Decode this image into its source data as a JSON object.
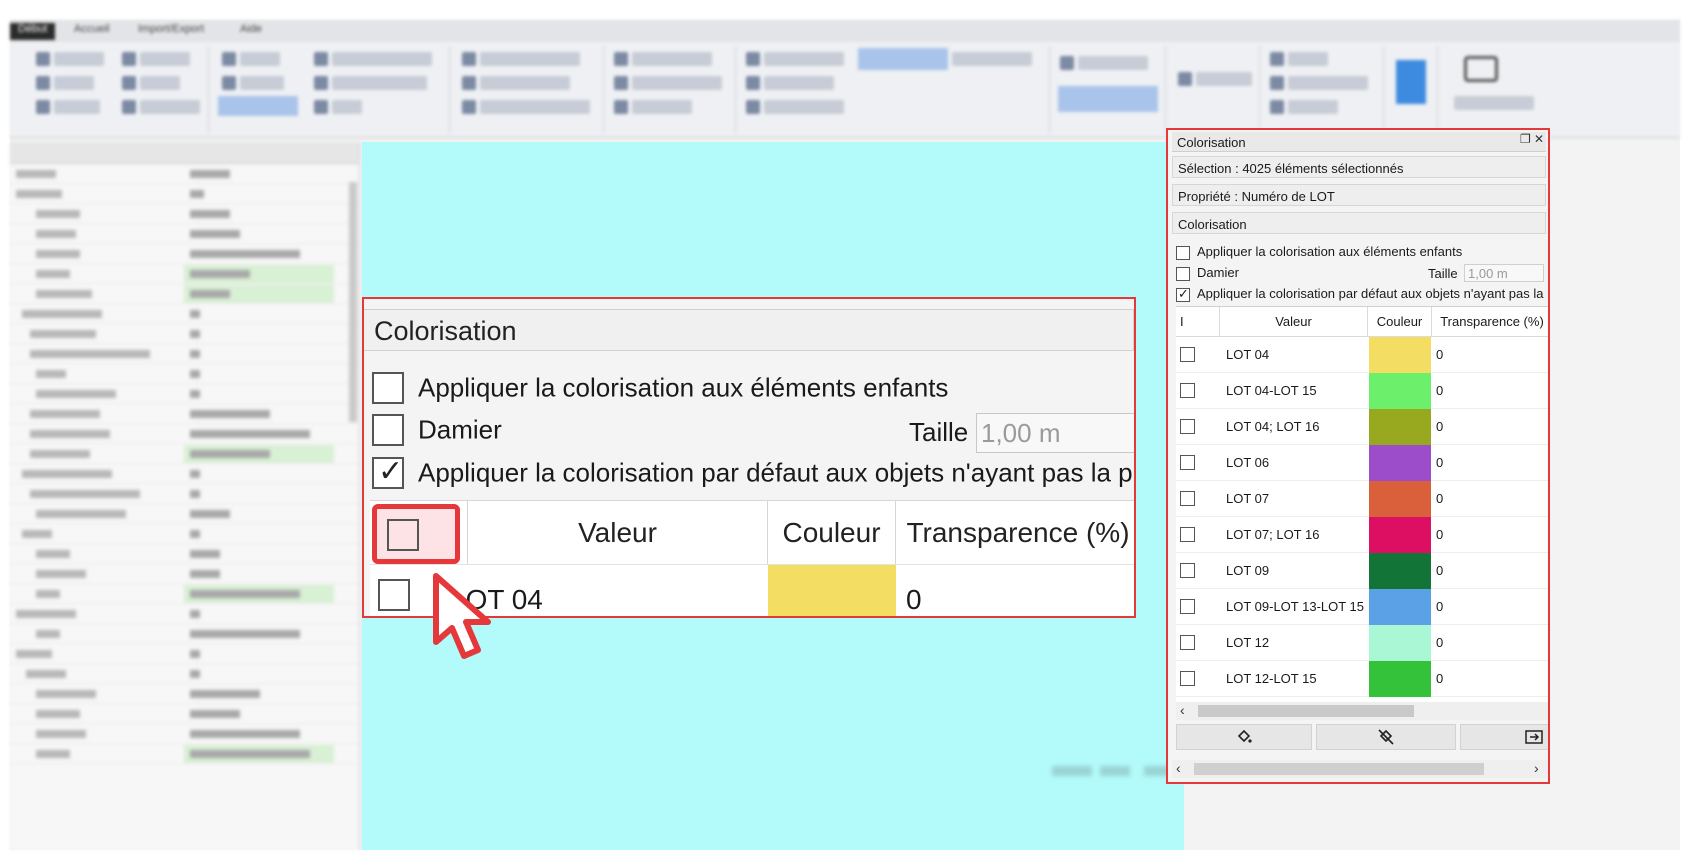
{
  "ribbon_tabs": [
    "Début",
    "Accueil",
    "Import/Export",
    "Aide"
  ],
  "zoom": {
    "title": "Colorisation",
    "options": [
      {
        "label": "Appliquer la colorisation aux éléments enfants",
        "checked": false
      },
      {
        "label": "Damier",
        "checked": false
      },
      {
        "label": "Appliquer la colorisation par défaut aux objets n'ayant pas la p",
        "checked": true
      }
    ],
    "taille_label": "Taille",
    "taille_value": "1,00 m",
    "columns": [
      "Valeur",
      "Couleur",
      "Transparence (%)"
    ],
    "row": {
      "value": "LOT 04",
      "color": "#f4dd63",
      "transparency": "0"
    }
  },
  "panel": {
    "title": "Colorisation",
    "float_icon": "❐",
    "close_icon": "✕",
    "selection": "Sélection : 4025 éléments sélectionnés",
    "property": "Propriété : Numéro de LOT",
    "section": "Colorisation",
    "options": [
      {
        "label": "Appliquer la colorisation aux éléments enfants",
        "checked": false
      },
      {
        "label": "Damier",
        "checked": false
      },
      {
        "label": "Appliquer la colorisation par défaut aux objets n'ayant pas la p",
        "checked": true
      }
    ],
    "taille_label": "Taille",
    "taille_value": "1,00 m",
    "columns": {
      "first": "I",
      "value": "Valeur",
      "color": "Couleur",
      "transparency": "Transparence (%)"
    },
    "rows": [
      {
        "value": "LOT 04",
        "color": "#f4dd63",
        "transparency": "0"
      },
      {
        "value": "LOT 04-LOT 15",
        "color": "#6cf06c",
        "transparency": "0"
      },
      {
        "value": "LOT 04; LOT 16",
        "color": "#98a920",
        "transparency": "0"
      },
      {
        "value": "LOT 06",
        "color": "#9b4dca",
        "transparency": "0"
      },
      {
        "value": "LOT 07",
        "color": "#d9603b",
        "transparency": "0"
      },
      {
        "value": "LOT 07; LOT 16",
        "color": "#dd0f63",
        "transparency": "0"
      },
      {
        "value": "LOT 09",
        "color": "#137438",
        "transparency": "0"
      },
      {
        "value": "LOT 09-LOT 13-LOT 15",
        "color": "#5aa1e6",
        "transparency": "0"
      },
      {
        "value": "LOT 12",
        "color": "#aaf7d6",
        "transparency": "0"
      },
      {
        "value": "LOT 12-LOT 15",
        "color": "#33c23a",
        "transparency": "0"
      }
    ],
    "toolbar": {
      "fill_icon": "paint-bucket-icon",
      "clear_icon": "no-fill-icon",
      "export_icon": "export-icon"
    },
    "scroll_left": "‹",
    "scroll_right": "›"
  },
  "colors": {
    "accent_red": "#e5383b",
    "viewport_cyan": "#b3fafa"
  }
}
